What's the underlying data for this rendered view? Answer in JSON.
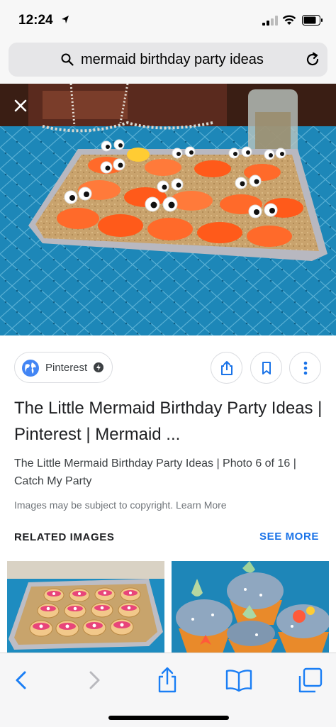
{
  "status_bar": {
    "time": "12:24"
  },
  "address_bar": {
    "query": "mermaid birthday party ideas"
  },
  "result": {
    "source": "Pinterest",
    "title": "The Little Mermaid Birthday Party Ideas | Pinterest | Mermaid ...",
    "description": "The Little Mermaid Birthday Party Ideas | Photo 6 of 16 | Catch My Party",
    "copyright": "Images may be subject to copyright. Learn More"
  },
  "related": {
    "heading": "RELATED IMAGES",
    "see_more": "SEE MORE"
  },
  "icons": {
    "close": "close-icon",
    "share": "share-icon",
    "bookmark": "bookmark-icon",
    "more": "more-vert-icon",
    "back": "chevron-left-icon",
    "forward": "chevron-right-icon",
    "bookmarks": "open-book-icon",
    "tabs": "tabs-icon"
  },
  "colors": {
    "link_blue": "#1a73e8",
    "ios_blue": "#1a7ef5",
    "table_cloth": "#1d87b8"
  }
}
